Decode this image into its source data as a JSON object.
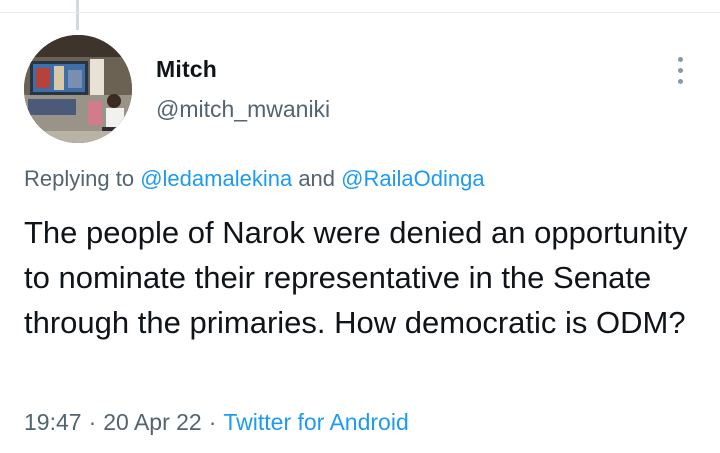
{
  "tweet": {
    "author": {
      "display_name": "Mitch",
      "handle": "@mitch_mwaniki"
    },
    "reply_context": {
      "prefix": "Replying to",
      "mentions": [
        "@ledamalekina",
        "@RailaOdinga"
      ],
      "conjunction": "and"
    },
    "text": "The people of Narok were denied an opportunity to nominate their representative in the Senate through the primaries. How democratic is ODM?",
    "time": "19:47",
    "date": "20 Apr 22",
    "separator": "·",
    "source": "Twitter for Android"
  },
  "icons": {
    "more": "more-vertical-icon"
  },
  "colors": {
    "accent": "#1d9bf0",
    "text_primary": "#0f1419",
    "text_secondary": "#536471"
  }
}
